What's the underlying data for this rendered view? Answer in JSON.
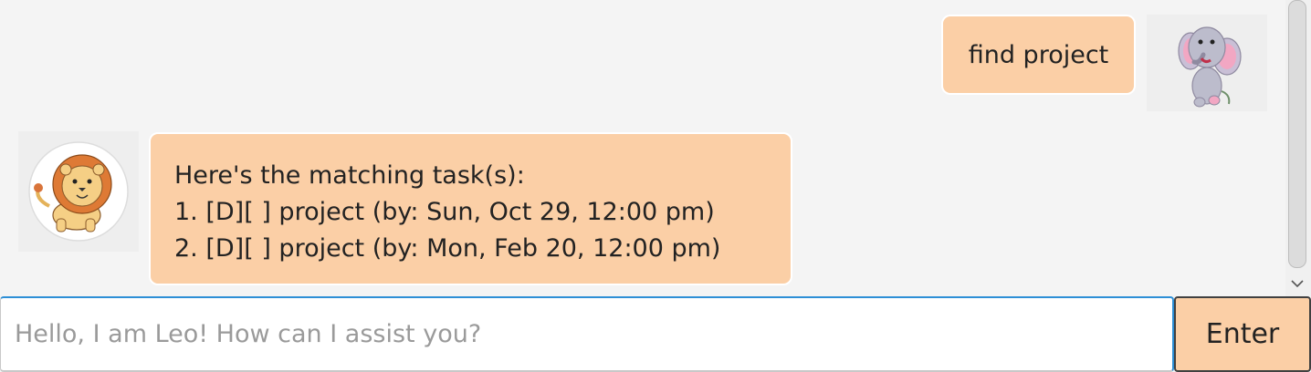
{
  "dialog": {
    "user_message": "find project",
    "bot_message": {
      "header": "Here's the matching task(s):",
      "lines": [
        "1. [D][ ] project (by: Sun, Oct 29, 12:00 pm)",
        "2. [D][ ] project (by: Mon, Feb 20, 12:00 pm)"
      ]
    },
    "user_avatar_icon": "elephant-icon",
    "bot_avatar_icon": "lion-icon"
  },
  "input": {
    "value": "",
    "placeholder": "Hello, I am Leo! How can I assist you?"
  },
  "enter_button": {
    "label": "Enter"
  },
  "colors": {
    "bubble": "#fbcfa6",
    "background": "#f4f4f4",
    "focus_border": "#2d8fd6"
  }
}
